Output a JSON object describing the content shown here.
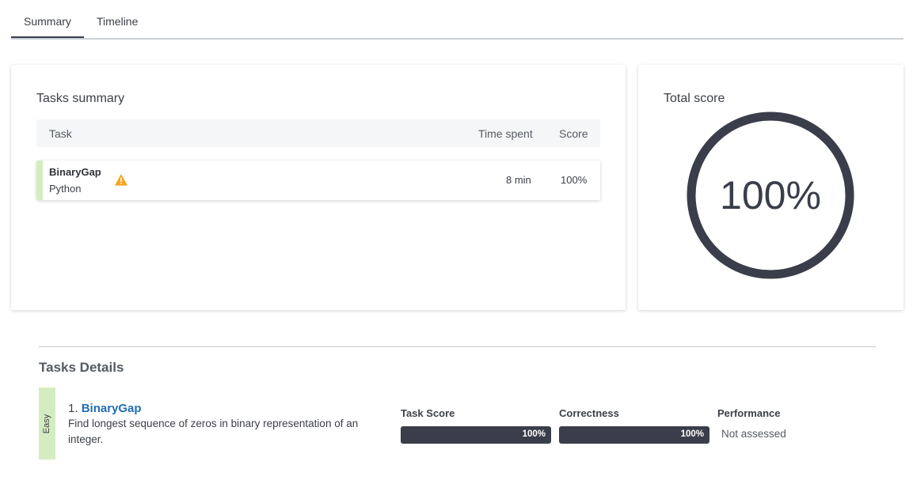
{
  "tabs": [
    {
      "label": "Summary",
      "active": true
    },
    {
      "label": "Timeline",
      "active": false
    }
  ],
  "tasks_summary": {
    "title": "Tasks summary",
    "columns": {
      "task": "Task",
      "time_spent": "Time spent",
      "score": "Score"
    },
    "rows": [
      {
        "name": "BinaryGap",
        "language": "Python",
        "time_spent": "8 min",
        "score": "100%",
        "warning_icon": "warning-triangle-icon",
        "difficulty_color": "#d4edc0"
      }
    ]
  },
  "total_score": {
    "title": "Total score",
    "value_text": "100%",
    "fraction": 1.0,
    "ring_color": "#3a3e4a"
  },
  "tasks_details": {
    "title": "Tasks Details",
    "items": [
      {
        "difficulty": "Easy",
        "difficulty_color": "#d4edc0",
        "number": "1.",
        "name": "BinaryGap",
        "description": "Find longest sequence of zeros in binary representation of an integer.",
        "metrics": {
          "task_score": {
            "label": "Task Score",
            "value": "100%",
            "fraction": 1.0
          },
          "correctness": {
            "label": "Correctness",
            "value": "100%",
            "fraction": 1.0
          },
          "performance": {
            "label": "Performance",
            "value": "Not assessed"
          }
        }
      }
    ]
  },
  "colors": {
    "accent": "#3a3e4a",
    "link": "#1f6fb2",
    "warning": "#f5a623",
    "easy": "#d4edc0"
  }
}
